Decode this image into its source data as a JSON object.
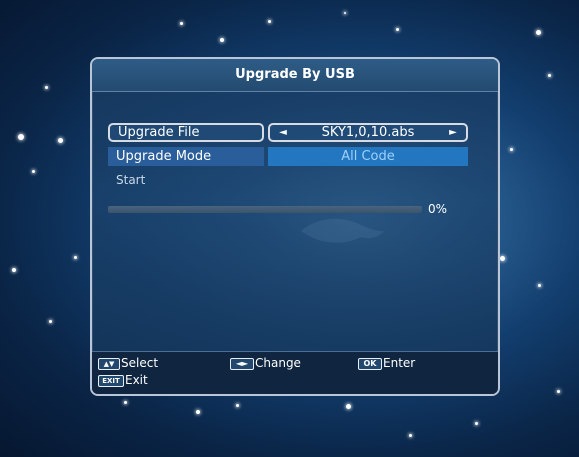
{
  "window": {
    "title": "Upgrade By USB"
  },
  "settings": {
    "upgrade_file": {
      "label": "Upgrade File",
      "value": "SKY1,0,10.abs"
    },
    "upgrade_mode": {
      "label": "Upgrade Mode",
      "value": "All Code"
    }
  },
  "action": {
    "start_label": "Start"
  },
  "progress": {
    "value": 0,
    "text": "0%"
  },
  "help": {
    "select_key": "▲▼",
    "select_label": "Select",
    "change_key": "◄►",
    "change_label": "Change",
    "enter_key": "OK",
    "enter_label": "Enter",
    "exit_key": "EXIT",
    "exit_label": "Exit"
  },
  "colors": {
    "accent_blue": "#2277c0",
    "panel_border": "#b8c6d8",
    "progress_fill": "#6da7e1"
  }
}
